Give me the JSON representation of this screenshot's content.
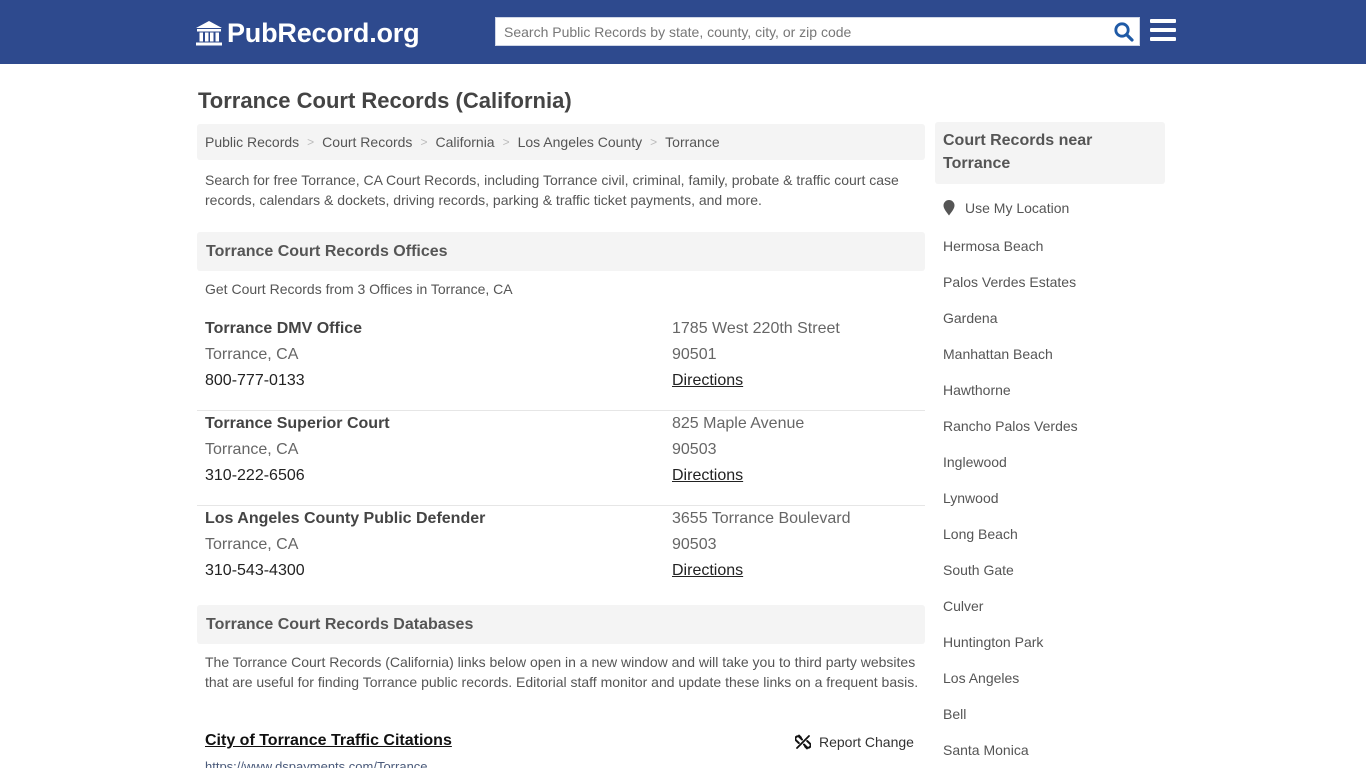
{
  "header": {
    "logo_text": "PubRecord.org",
    "logo_icon": "courthouse-icon",
    "search_placeholder": "Search Public Records by state, county, city, or zip code",
    "search_value": "",
    "search_icon": "search-icon",
    "menu_icon": "hamburger-menu-icon"
  },
  "colors": {
    "header_bg": "#2e4a8e",
    "panel_bg": "#f4f4f4",
    "search_icon": "#1f5aa6"
  },
  "page_title": "Torrance Court Records (California)",
  "breadcrumb": [
    "Public Records",
    "Court Records",
    "California",
    "Los Angeles County",
    "Torrance"
  ],
  "intro": "Search for free Torrance, CA Court Records, including Torrance civil, criminal, family, probate & traffic court case records, calendars & dockets, driving records, parking & traffic ticket payments, and more.",
  "offices_section": {
    "title": "Torrance Court Records Offices",
    "subtitle": "Get Court Records from 3 Offices in Torrance, CA",
    "offices": [
      {
        "name": "Torrance DMV Office",
        "city": "Torrance, CA",
        "phone": "800-777-0133",
        "address": "1785 West 220th Street",
        "zip": "90501",
        "directions": "Directions"
      },
      {
        "name": "Torrance Superior Court",
        "city": "Torrance, CA",
        "phone": "310-222-6506",
        "address": "825 Maple Avenue",
        "zip": "90503",
        "directions": "Directions"
      },
      {
        "name": "Los Angeles County Public Defender",
        "city": "Torrance, CA",
        "phone": "310-543-4300",
        "address": "3655 Torrance Boulevard",
        "zip": "90503",
        "directions": "Directions"
      }
    ]
  },
  "databases_section": {
    "title": "Torrance Court Records Databases",
    "intro": "The Torrance Court Records (California) links below open in a new window and will take you to third party websites that are useful for finding Torrance public records. Editorial staff monitor and update these links on a frequent basis.",
    "links": [
      {
        "title": "City of Torrance Traffic Citations",
        "url": "https://www.dspayments.com/Torrance",
        "report_label": "Report Change"
      }
    ]
  },
  "sidebar": {
    "title": "Court Records near Torrance",
    "use_location": "Use My Location",
    "cities": [
      "Hermosa Beach",
      "Palos Verdes Estates",
      "Gardena",
      "Manhattan Beach",
      "Hawthorne",
      "Rancho Palos Verdes",
      "Inglewood",
      "Lynwood",
      "Long Beach",
      "South Gate",
      "Culver",
      "Huntington Park",
      "Los Angeles",
      "Bell",
      "Santa Monica"
    ]
  }
}
